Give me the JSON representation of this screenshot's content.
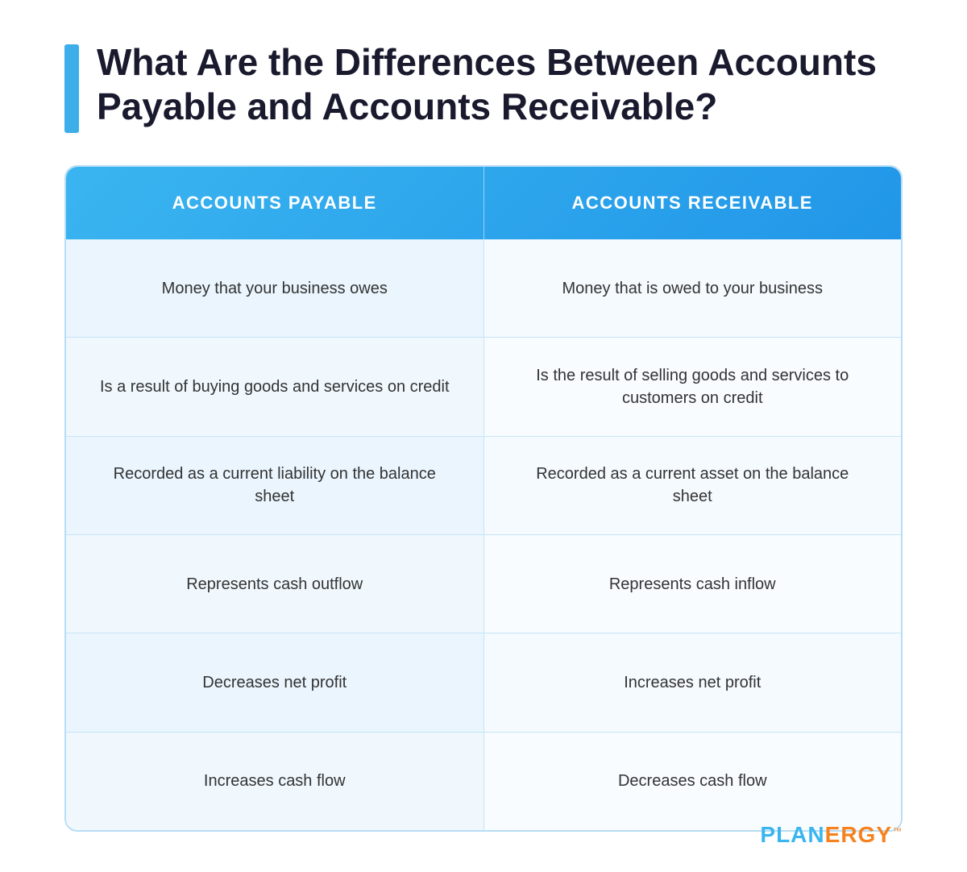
{
  "page": {
    "title": "What Are the Differences Between Accounts Payable and Accounts Receivable?",
    "accent_color": "#3ab5f0"
  },
  "table": {
    "header": {
      "col1": "ACCOUNTS PAYABLE",
      "col2": "ACCOUNTS RECEIVABLE"
    },
    "rows": [
      {
        "col1": "Money that your business owes",
        "col2": "Money that is owed to your business"
      },
      {
        "col1": "Is a result of buying goods and services on credit",
        "col2": "Is the result of selling goods and services to customers on credit"
      },
      {
        "col1": "Recorded as a current liability on the balance sheet",
        "col2": "Recorded as a current asset on the balance sheet"
      },
      {
        "col1": "Represents cash outflow",
        "col2": "Represents cash inflow"
      },
      {
        "col1": "Decreases net profit",
        "col2": "Increases net profit"
      },
      {
        "col1": "Increases cash flow",
        "col2": "Decreases cash flow"
      }
    ]
  },
  "branding": {
    "plan": "PLAN",
    "ergy": "ERGY",
    "tm": "™"
  }
}
